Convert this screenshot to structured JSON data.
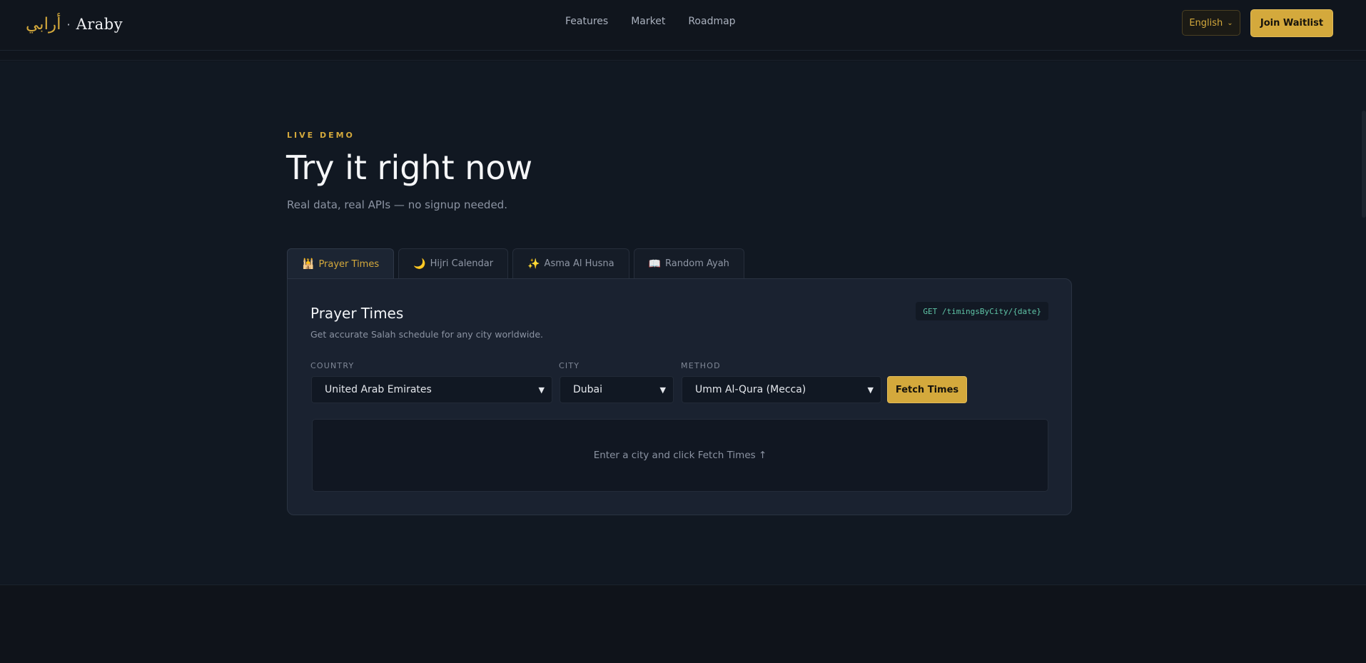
{
  "brand": {
    "arabic": "أرابي",
    "separator": "·",
    "name": "Araby"
  },
  "nav": {
    "items": [
      "Features",
      "Market",
      "Roadmap"
    ]
  },
  "header": {
    "language": "English",
    "join_label": "Join Waitlist"
  },
  "hero": {
    "eyebrow": "LIVE DEMO",
    "title": "Try it right now",
    "subtitle": "Real data, real APIs — no signup needed."
  },
  "tabs": [
    {
      "icon": "🕌",
      "label": "Prayer Times",
      "active": true
    },
    {
      "icon": "🌙",
      "label": "Hijri Calendar",
      "active": false
    },
    {
      "icon": "✨",
      "label": "Asma Al Husna",
      "active": false
    },
    {
      "icon": "📖",
      "label": "Random Ayah",
      "active": false
    }
  ],
  "card": {
    "title": "Prayer Times",
    "description": "Get accurate Salah schedule for any city worldwide.",
    "endpoint": "GET /timingsByCity/{date}",
    "fields": {
      "country": {
        "label": "COUNTRY",
        "value": "United Arab Emirates"
      },
      "city": {
        "label": "CITY",
        "value": "Dubai"
      },
      "method": {
        "label": "METHOD",
        "value": "Umm Al-Qura (Mecca)"
      }
    },
    "fetch_label": "Fetch Times",
    "result_placeholder": "Enter a city and click Fetch Times ↑"
  },
  "colors": {
    "accent": "#d4a93c",
    "background": "#111822",
    "card": "#1a2230",
    "endpoint_text": "#5fc4a6"
  }
}
